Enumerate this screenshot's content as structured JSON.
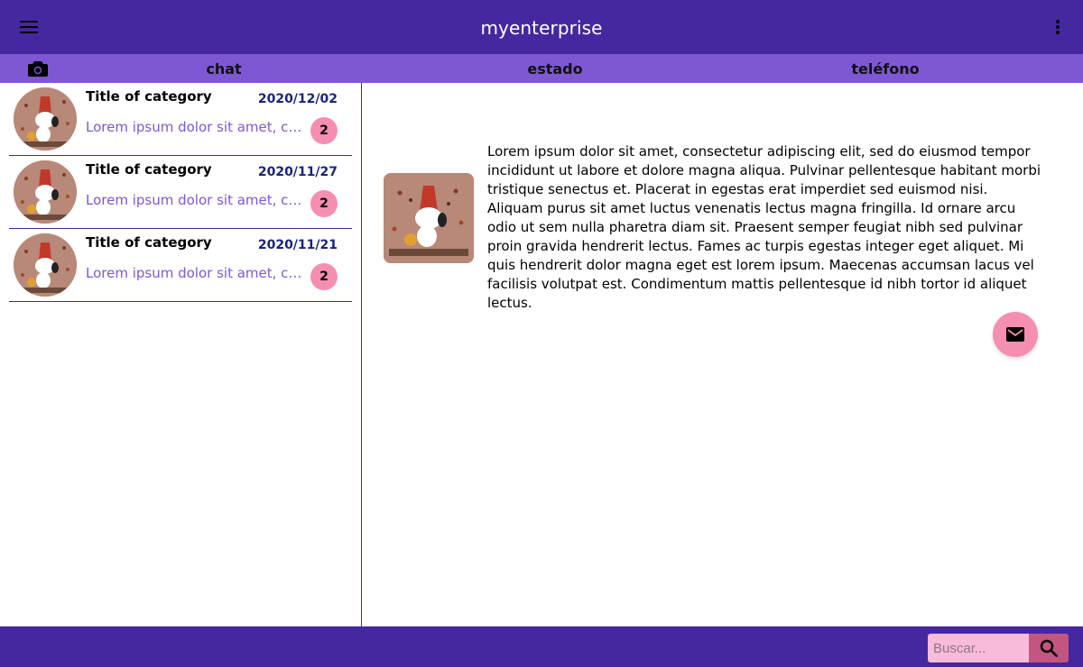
{
  "app": {
    "title": "myenterprise",
    "menu_icon": "menu-icon",
    "more_icon": "more-vert-icon"
  },
  "tabs": {
    "camera_icon": "camera-icon",
    "items": [
      {
        "label": "chat"
      },
      {
        "label": "estado"
      },
      {
        "label": "teléfono"
      }
    ]
  },
  "chats": [
    {
      "title": "Title of category",
      "date": "2020/12/02",
      "preview": "Lorem ipsum dolor sit amet, consectetur adipiscing elit",
      "badge": "2"
    },
    {
      "title": "Title of category",
      "date": "2020/11/27",
      "preview": "Lorem ipsum dolor sit amet, consectetur adipiscing elit",
      "badge": "2"
    },
    {
      "title": "Title of category",
      "date": "2020/11/21",
      "preview": "Lorem ipsum dolor sit amet, consectetur adipiscing elit",
      "badge": "2"
    }
  ],
  "detail": {
    "body": "Lorem ipsum dolor sit amet, consectetur adipiscing elit, sed do eiusmod tempor incididunt ut labore et dolore magna aliqua. Pulvinar pellentesque habitant morbi tristique senectus et. Placerat in egestas erat imperdiet sed euismod nisi. Aliquam purus sit amet luctus venenatis lectus magna fringilla. Id ornare arcu odio ut sem nulla pharetra diam sit. Praesent semper feugiat nibh sed pulvinar proin gravida hendrerit lectus. Fames ac turpis egestas integer eget aliquet. Mi quis hendrerit dolor magna eget est lorem ipsum. Maecenas accumsan lacus vel facilisis volutpat est. Condimentum mattis pellentesque id nibh tortor id aliquet lectus.",
    "fab_icon": "mail-icon"
  },
  "search": {
    "placeholder": "Buscar...",
    "value": "",
    "icon": "search-icon"
  },
  "colors": {
    "primary": "#4527a0",
    "tab_bar": "#7e57d2",
    "accent": "#f48fb1",
    "date_text": "#1a237e",
    "preview_text": "#7e57d2"
  }
}
